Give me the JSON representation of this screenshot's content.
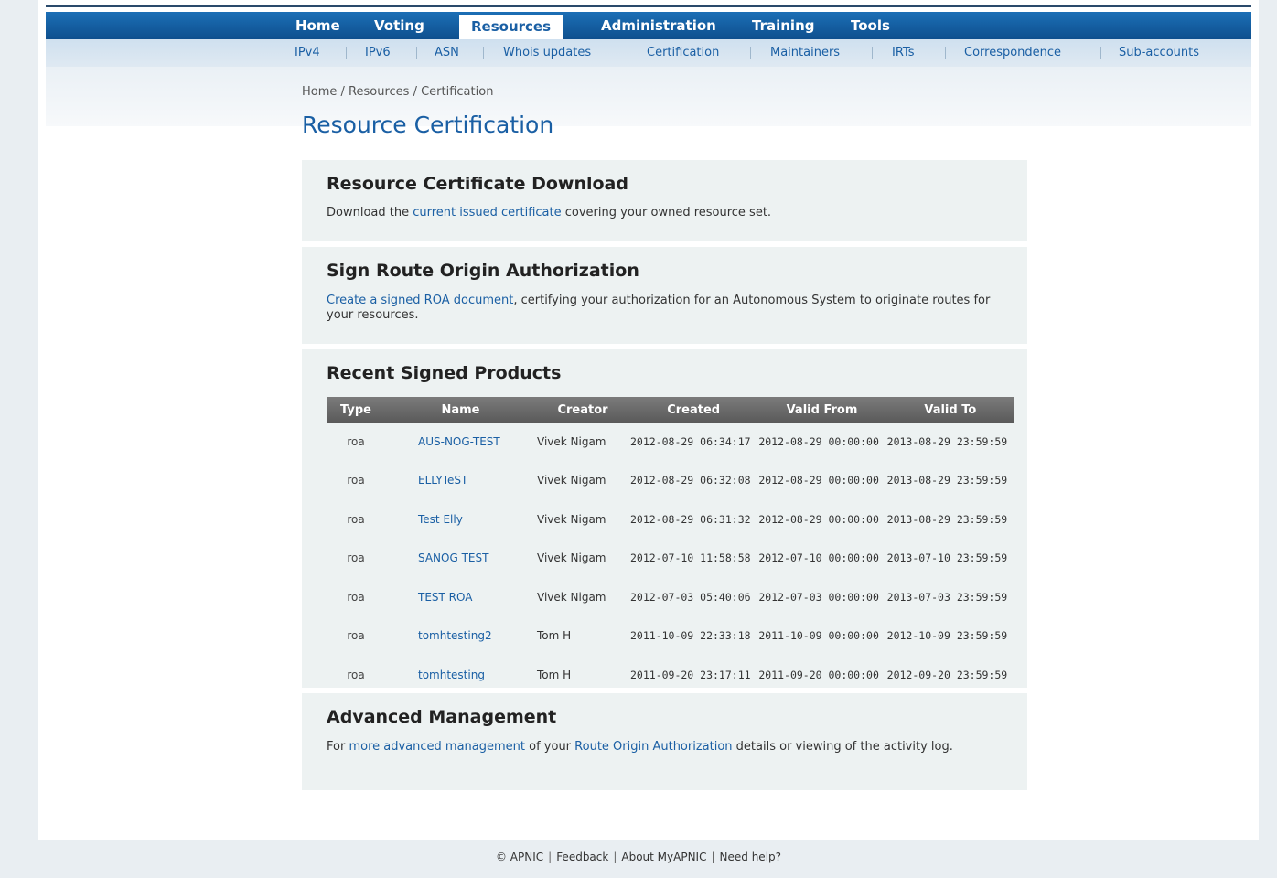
{
  "nav": {
    "items": [
      {
        "label": "Home"
      },
      {
        "label": "Voting"
      },
      {
        "label": "Resources"
      },
      {
        "label": "Administration"
      },
      {
        "label": "Training"
      },
      {
        "label": "Tools"
      }
    ],
    "active": "Resources"
  },
  "subnav": {
    "items": [
      {
        "label": "IPv4"
      },
      {
        "label": "IPv6"
      },
      {
        "label": "ASN"
      },
      {
        "label": "Whois updates"
      },
      {
        "label": "Certification"
      },
      {
        "label": "Maintainers"
      },
      {
        "label": "IRTs"
      },
      {
        "label": "Correspondence"
      },
      {
        "label": "Sub-accounts"
      }
    ]
  },
  "breadcrumb": {
    "home": "Home",
    "sep": " / ",
    "resources": "Resources",
    "current": "Certification"
  },
  "page_title": "Resource Certification",
  "download": {
    "heading": "Resource Certificate Download",
    "pre": "Download the ",
    "link": "current issued certificate",
    "post": " covering your owned resource set."
  },
  "roa": {
    "heading": "Sign Route Origin Authorization",
    "link": "Create a signed ROA document",
    "post": ", certifying your authorization for an Autonomous System to originate routes for your resources."
  },
  "recent": {
    "heading": "Recent Signed Products",
    "columns": [
      "Type",
      "Name",
      "Creator",
      "Created",
      "Valid From",
      "Valid To"
    ],
    "rows": [
      {
        "type": "roa",
        "name": "AUS-NOG-TEST",
        "creator": "Vivek Nigam",
        "created": "2012-08-29 06:34:17",
        "from": "2012-08-29 00:00:00",
        "to": "2013-08-29 23:59:59"
      },
      {
        "type": "roa",
        "name": "ELLYTeST",
        "creator": "Vivek Nigam",
        "created": "2012-08-29 06:32:08",
        "from": "2012-08-29 00:00:00",
        "to": "2013-08-29 23:59:59"
      },
      {
        "type": "roa",
        "name": "Test Elly",
        "creator": "Vivek Nigam",
        "created": "2012-08-29 06:31:32",
        "from": "2012-08-29 00:00:00",
        "to": "2013-08-29 23:59:59"
      },
      {
        "type": "roa",
        "name": "SANOG TEST",
        "creator": "Vivek Nigam",
        "created": "2012-07-10 11:58:58",
        "from": "2012-07-10 00:00:00",
        "to": "2013-07-10 23:59:59"
      },
      {
        "type": "roa",
        "name": "TEST ROA",
        "creator": "Vivek Nigam",
        "created": "2012-07-03 05:40:06",
        "from": "2012-07-03 00:00:00",
        "to": "2013-07-03 23:59:59"
      },
      {
        "type": "roa",
        "name": "tomhtesting2",
        "creator": "Tom H",
        "created": "2011-10-09 22:33:18",
        "from": "2011-10-09 00:00:00",
        "to": "2012-10-09 23:59:59"
      },
      {
        "type": "roa",
        "name": "tomhtesting",
        "creator": "Tom H",
        "created": "2011-09-20 23:17:11",
        "from": "2011-09-20 00:00:00",
        "to": "2012-09-20 23:59:59"
      }
    ]
  },
  "advanced": {
    "heading": "Advanced Management",
    "pre": "For ",
    "link1": "more advanced management",
    "mid": " of your ",
    "link2": "Route Origin Authorization",
    "post": " details or viewing of the activity log."
  },
  "footer": {
    "copyright": "© APNIC",
    "feedback": "Feedback",
    "about": "About MyAPNIC",
    "help": "Need help?",
    "sep": "|"
  },
  "colors": {
    "primary": "#1a5fa4",
    "nav_dark": "#0e4f8e",
    "panel": "#edf2f2",
    "table_header": "#6a6a6a"
  }
}
